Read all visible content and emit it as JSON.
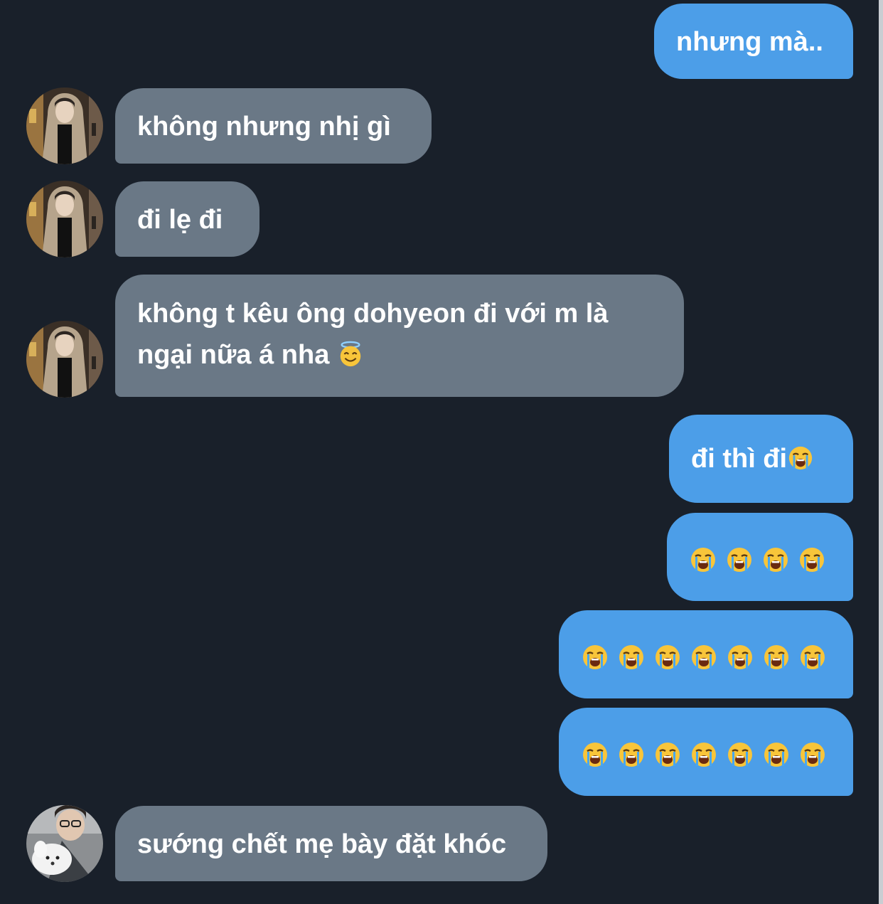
{
  "messages": {
    "m1": {
      "text": "nhưng mà.."
    },
    "m2": {
      "text": "không nhưng nhị gì"
    },
    "m3": {
      "text": "đi lẹ đi"
    },
    "m4": {
      "line1": "không t kêu ông dohyeon đi với m là",
      "line2": "ngại nữa á nha",
      "emoji": "smiling-face-with-halo-icon"
    },
    "m5": {
      "text": "đi thì đi",
      "emoji": "loudly-crying-face-icon"
    },
    "m6": {
      "emoji": "loudly-crying-face-icon",
      "count": 4
    },
    "m7": {
      "emoji": "loudly-crying-face-icon",
      "count": 7
    },
    "m8": {
      "emoji": "loudly-crying-face-icon",
      "count": 7
    },
    "m9": {
      "text": "sướng chết mẹ bày đặt khóc"
    }
  },
  "colors": {
    "background": "#19202a",
    "outgoing_bubble": "#4c9ee8",
    "incoming_bubble": "#6a7886",
    "text": "#ffffff"
  }
}
